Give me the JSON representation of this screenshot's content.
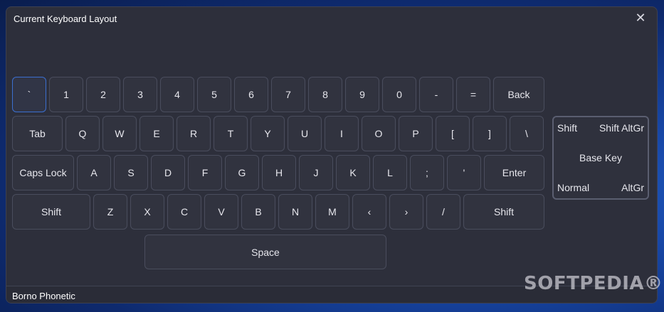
{
  "window": {
    "title": "Current Keyboard Layout",
    "close_icon": "close-icon"
  },
  "keyboard": {
    "row1": [
      "`",
      "1",
      "2",
      "3",
      "4",
      "5",
      "6",
      "7",
      "8",
      "9",
      "0",
      "-",
      "=",
      "Back"
    ],
    "row2": [
      "Tab",
      "Q",
      "W",
      "E",
      "R",
      "T",
      "Y",
      "U",
      "I",
      "O",
      "P",
      "[",
      "]",
      "\\"
    ],
    "row3": [
      "Caps Lock",
      "A",
      "S",
      "D",
      "F",
      "G",
      "H",
      "J",
      "K",
      "L",
      ";",
      "'",
      "Enter"
    ],
    "row4": [
      "Shift",
      "Z",
      "X",
      "C",
      "V",
      "B",
      "N",
      "M",
      "‹",
      "›",
      "/",
      "Shift"
    ],
    "space": "Space",
    "selected_key": "`"
  },
  "legend": {
    "shift": "Shift",
    "shift_altgr": "Shift AltGr",
    "base_key": "Base Key",
    "normal": "Normal",
    "altgr": "AltGr"
  },
  "status_bar": {
    "layout_name": "Borno Phonetic"
  },
  "watermark": "SOFTPEDIA®",
  "colors": {
    "window_bg": "#2d2f3b",
    "key_bg": "#31333f",
    "key_border": "#4a4d5d",
    "selected_border": "#3b6fd0"
  }
}
